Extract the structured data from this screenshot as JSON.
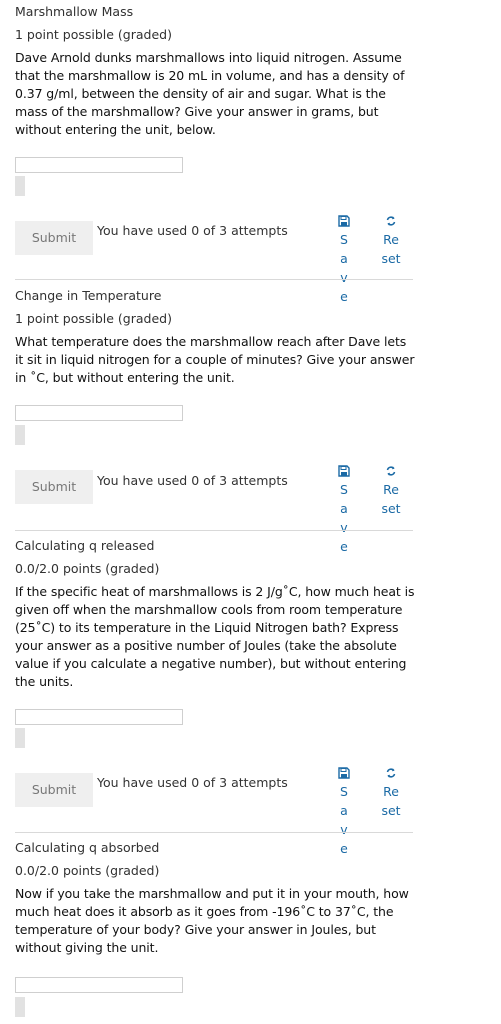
{
  "problems": [
    {
      "title": "Marshmallow Mass",
      "points": "1 point possible (graded)",
      "prompt": "Dave Arnold dunks marshmallows into liquid nitrogen. Assume that the marshmallow is 20 mL in volume, and has a density of 0.37 g/ml, between the density of air and sugar. What is the mass of the marshmallow? Give your answer in grams, but without entering the unit, below.",
      "submit_label": "Submit",
      "attempts": "You have used 0 of 3 attempts",
      "save_label": "Save",
      "reset_label": "Reset"
    },
    {
      "title": "Change in Temperature",
      "points": "1 point possible (graded)",
      "prompt": "What temperature does the marshmallow reach after Dave lets it sit in liquid nitrogen for a couple of minutes? Give your answer in ˚C, but without entering the unit.",
      "submit_label": "Submit",
      "attempts": "You have used 0 of 3 attempts",
      "save_label": "Save",
      "reset_label": "Reset"
    },
    {
      "title": "Calculating q released",
      "points": "0.0/2.0 points (graded)",
      "prompt": "If the specific heat of marshmallows is 2 J/g˚C, how much heat is given off when the marshmallow cools from room temperature (25˚C) to its temperature in the Liquid Nitrogen bath? Express your answer as a positive number of Joules (take the absolute value if you calculate a negative number), but without entering the units.",
      "submit_label": "Submit",
      "attempts": "You have used 0 of 3 attempts",
      "save_label": "Save",
      "reset_label": "Reset"
    },
    {
      "title": "Calculating q absorbed",
      "points": "0.0/2.0 points (graded)",
      "prompt": "Now if you take the marshmallow and put it in your mouth, how much heat does it absorb as it goes from -196˚C to 37˚C, the temperature of your body? Give your answer in Joules, but without giving the unit."
    }
  ],
  "icons": {
    "save": "floppy-disk-icon",
    "reset": "refresh-icon"
  },
  "colors": {
    "link": "#1b6aa5",
    "submit_bg": "#efefef",
    "divider": "#d9d9d9"
  }
}
